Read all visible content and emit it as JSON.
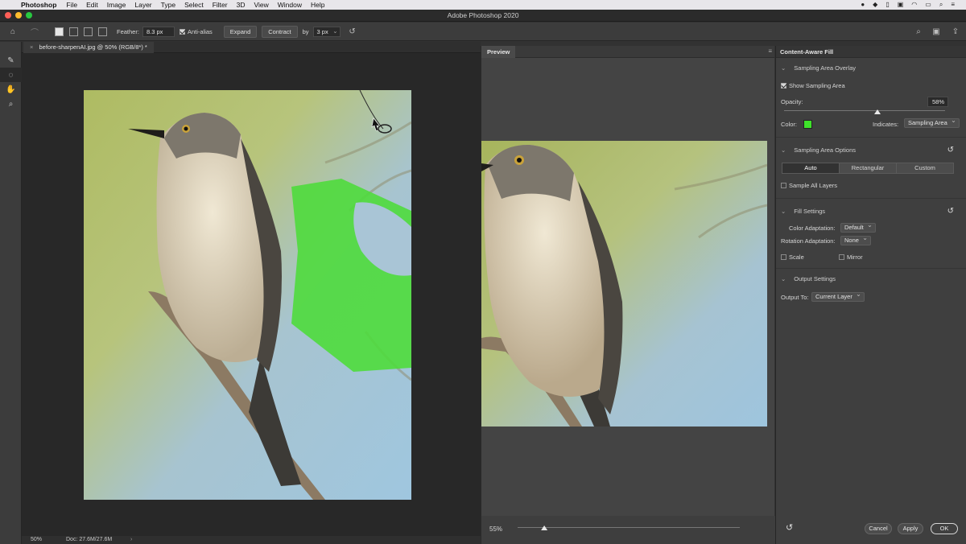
{
  "menubar": {
    "app_name": "Photoshop",
    "items": [
      "File",
      "Edit",
      "Image",
      "Layer",
      "Type",
      "Select",
      "Filter",
      "3D",
      "View",
      "Window",
      "Help"
    ]
  },
  "window": {
    "title": "Adobe Photoshop 2020"
  },
  "options": {
    "feather_label": "Feather:",
    "feather_value": "8.3 px",
    "antialias_label": "Anti-alias",
    "expand_label": "Expand",
    "contract_label": "Contract",
    "by_label": "by",
    "by_value": "3 px"
  },
  "document": {
    "tab_title": "before-sharpenAI.jpg @ 50% (RGB/8*) *",
    "zoom": "50%",
    "doc_size": "Doc: 27.6M/27.6M"
  },
  "preview": {
    "title": "Preview",
    "zoom": "55%",
    "zoom_fraction": 0.12
  },
  "panel": {
    "title": "Content-Aware Fill",
    "sampling_overlay": {
      "header": "Sampling Area Overlay",
      "show_label": "Show Sampling Area",
      "opacity_label": "Opacity:",
      "opacity_value": "58%",
      "opacity_fraction": 0.58,
      "color_label": "Color:",
      "color_value": "#3ee22a",
      "indicates_label": "Indicates:",
      "indicates_value": "Sampling Area"
    },
    "sampling_options": {
      "header": "Sampling Area Options",
      "modes": [
        "Auto",
        "Rectangular",
        "Custom"
      ],
      "selected_mode": "Auto",
      "sample_all_layers": "Sample All Layers"
    },
    "fill_settings": {
      "header": "Fill Settings",
      "color_adaptation_label": "Color Adaptation:",
      "color_adaptation_value": "Default",
      "rotation_adaptation_label": "Rotation Adaptation:",
      "rotation_adaptation_value": "None",
      "scale_label": "Scale",
      "mirror_label": "Mirror"
    },
    "output_settings": {
      "header": "Output Settings",
      "output_to_label": "Output To:",
      "output_to_value": "Current Layer"
    },
    "buttons": {
      "cancel": "Cancel",
      "apply": "Apply",
      "ok": "OK"
    }
  }
}
